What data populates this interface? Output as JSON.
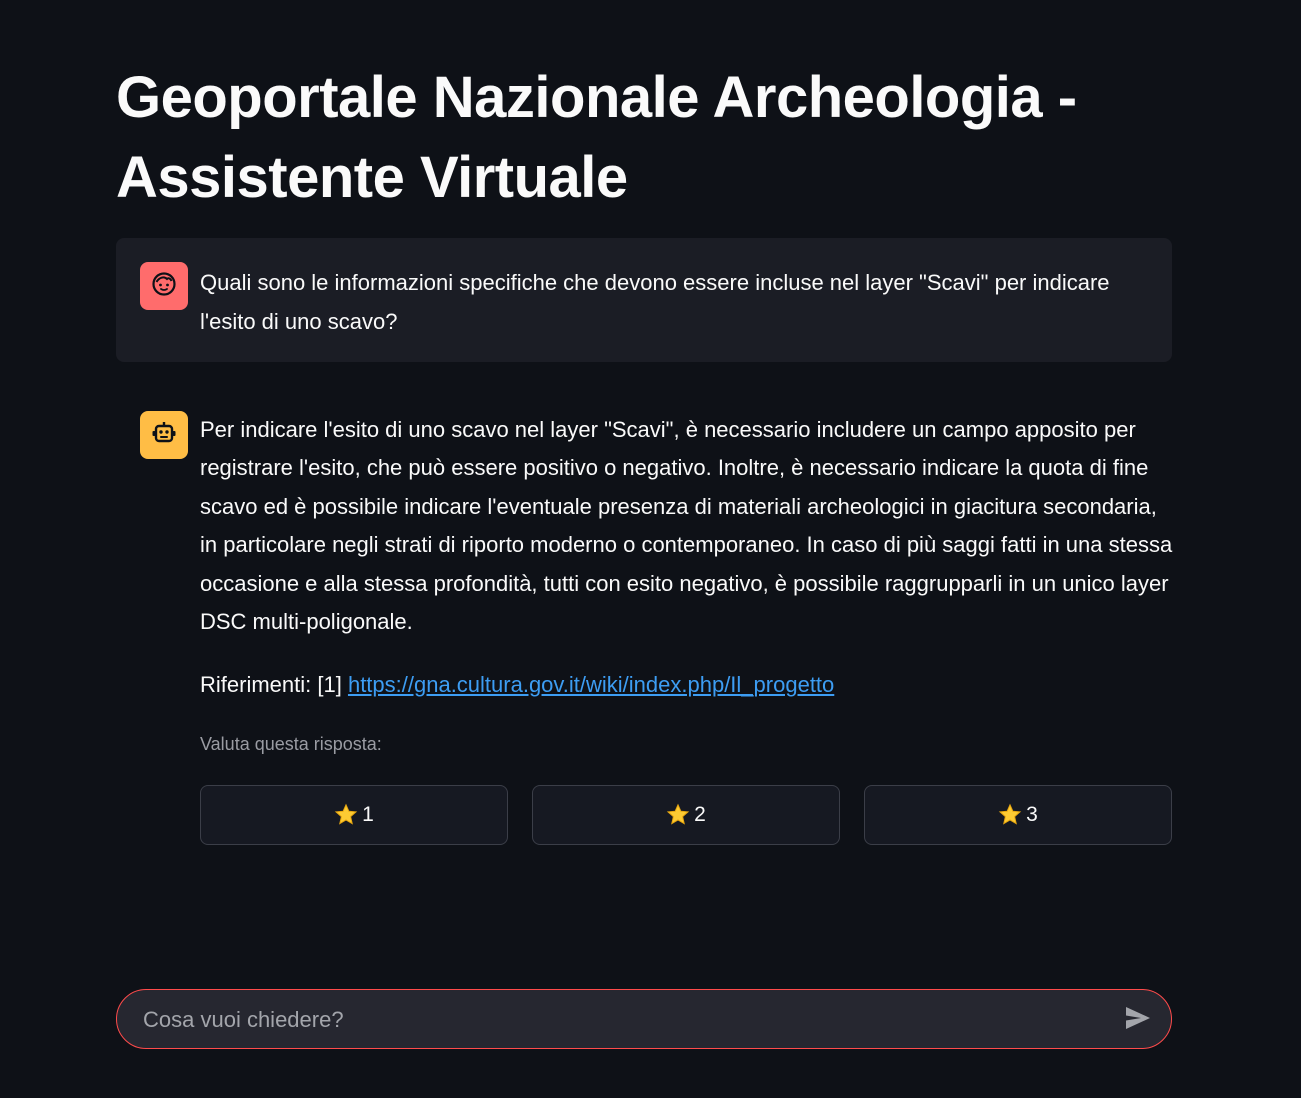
{
  "page": {
    "title": "Geoportale Nazionale Archeologia - Assistente Virtuale"
  },
  "messages": {
    "user": {
      "avatar_icon": "face-icon",
      "avatar_color": "#ff6c6c",
      "text": "Quali sono le informazioni specifiche che devono essere incluse nel layer \"Scavi\" per indicare l'esito di uno scavo?"
    },
    "assistant": {
      "avatar_icon": "robot-icon",
      "avatar_color": "#ffbd45",
      "text": "Per indicare l'esito di uno scavo nel layer \"Scavi\", è necessario includere un campo apposito per registrare l'esito, che può essere positivo o negativo. Inoltre, è necessario indicare la quota di fine scavo ed è possibile indicare l'eventuale presenza di materiali archeologici in giacitura secondaria, in particolare negli strati di riporto moderno o contemporaneo. In caso di più saggi fatti in una stessa occasione e alla stessa profondità, tutti con esito negativo, è possibile raggrupparli in un unico layer DSC multi-poligonale.",
      "references_label": "Riferimenti: [1]",
      "reference_link": "https://gna.cultura.gov.it/wiki/index.php/Il_progetto"
    }
  },
  "rating": {
    "label": "Valuta questa risposta:",
    "options": [
      {
        "icon": "star-icon",
        "label": "1"
      },
      {
        "icon": "star-icon",
        "label": "2"
      },
      {
        "icon": "star-icon",
        "label": "3"
      }
    ]
  },
  "chat_input": {
    "placeholder": "Cosa vuoi chiedere?",
    "value": "",
    "send_icon": "send-icon",
    "border_color": "#ff4b4b"
  },
  "colors": {
    "background": "#0e1117",
    "user_bubble": "#1b1d25",
    "link": "#3d9df3"
  }
}
